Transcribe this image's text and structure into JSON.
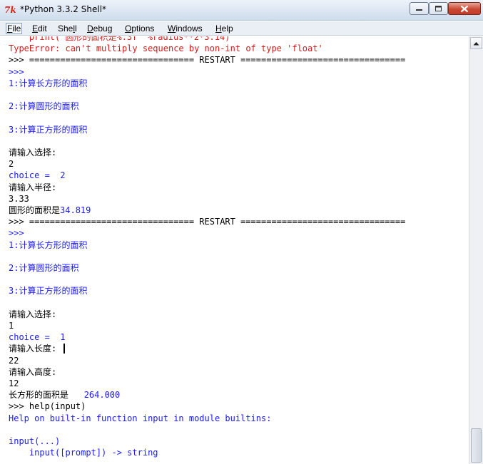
{
  "window": {
    "icon_text": "7k",
    "title": "*Python 3.3.2 Shell*"
  },
  "menu": [
    {
      "label": "File",
      "underline": "F",
      "rest": "ile"
    },
    {
      "label": "Edit",
      "underline": "E",
      "rest": "dit"
    },
    {
      "label": "Shell",
      "pre": "She",
      "underline": "l",
      "rest": "l"
    },
    {
      "label": "Debug",
      "underline": "D",
      "rest": "ebug"
    },
    {
      "label": "Options",
      "underline": "O",
      "rest": "ptions"
    },
    {
      "label": "Windows",
      "underline": "W",
      "rest": "indows"
    },
    {
      "label": "Help",
      "underline": "H",
      "rest": "elp"
    }
  ],
  "console": {
    "lines": [
      {
        "text": "    print('圆形的面积是%.3f' %radius**2*3.14)",
        "color": "red"
      },
      {
        "text": "TypeError: can't multiply sequence by non-int of type 'float'",
        "color": "red"
      },
      {
        "text": ">>> ================================ RESTART ================================",
        "color": "blk"
      },
      {
        "text": ">>>",
        "color": "blue"
      },
      {
        "text": "1:计算长方形的面积",
        "color": "blue"
      },
      {
        "text": "",
        "color": "blk"
      },
      {
        "text": "2:计算圆形的面积",
        "color": "blue"
      },
      {
        "text": "",
        "color": "blk"
      },
      {
        "text": "3:计算正方形的面积",
        "color": "blue"
      },
      {
        "text": "",
        "color": "blk"
      },
      {
        "text": "请输入选择:",
        "color": "blk"
      },
      {
        "text": "2",
        "color": "blk"
      },
      {
        "text": "choice =  2",
        "color": "blue"
      },
      {
        "text": "请输入半径:",
        "color": "blk"
      },
      {
        "text": "3.33",
        "color": "blk"
      },
      {
        "text": "圆形的面积是34.819",
        "color": "mixed"
      },
      {
        "text": ">>> ================================ RESTART ================================",
        "color": "blk"
      },
      {
        "text": ">>>",
        "color": "blue"
      },
      {
        "text": "1:计算长方形的面积",
        "color": "blue"
      },
      {
        "text": "",
        "color": "blk"
      },
      {
        "text": "2:计算圆形的面积",
        "color": "blue"
      },
      {
        "text": "",
        "color": "blk"
      },
      {
        "text": "3:计算正方形的面积",
        "color": "blue"
      },
      {
        "text": "",
        "color": "blk"
      },
      {
        "text": "请输入选择:",
        "color": "blk"
      },
      {
        "text": "1",
        "color": "blk"
      },
      {
        "text": "choice =  1",
        "color": "blue"
      },
      {
        "text": "请输入长度:",
        "color": "blk"
      },
      {
        "text": "22",
        "color": "blk"
      },
      {
        "text": "请输入高度:",
        "color": "blk"
      },
      {
        "text": "12",
        "color": "blk"
      },
      {
        "text": "长方形的面积是   264.000",
        "color": "mixed"
      },
      {
        "text": ">>> help(input)",
        "color": "mixed"
      },
      {
        "text": "Help on built-in function input in module builtins:",
        "color": "blue"
      },
      {
        "text": "",
        "color": "blk"
      },
      {
        "text": "input(...)",
        "color": "blue"
      },
      {
        "text": "    input([prompt]) -> string",
        "color": "blue"
      }
    ]
  },
  "colors": {
    "error_red": "#d41c1c",
    "output_blue": "#1a1aff",
    "text_black": "#000000"
  }
}
